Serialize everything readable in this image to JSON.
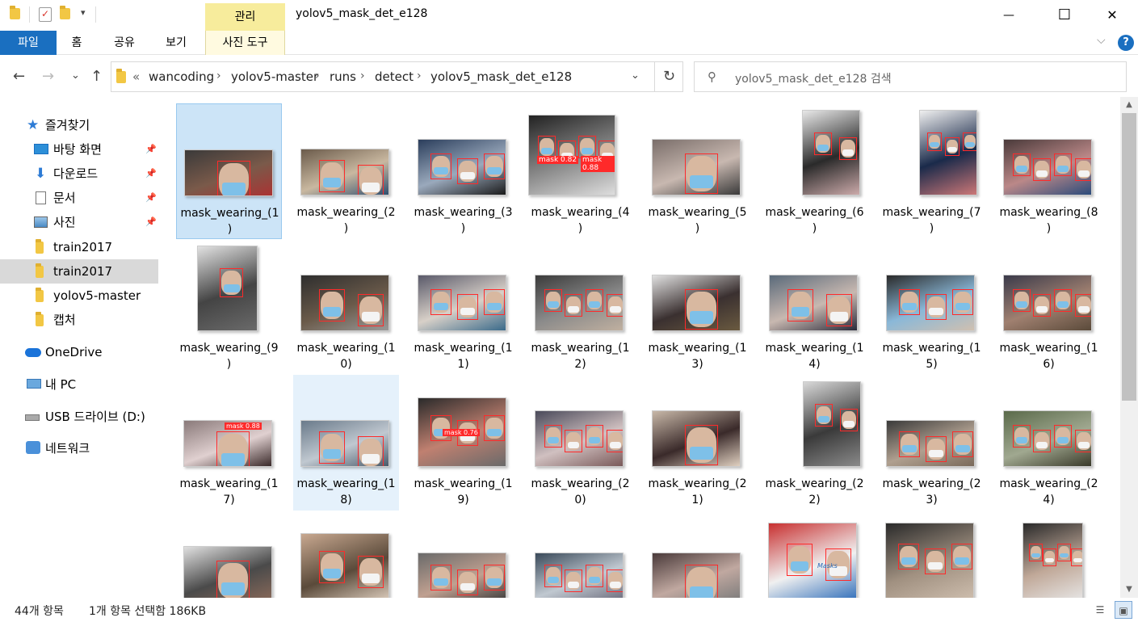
{
  "window": {
    "title": "yolov5_mask_det_e128",
    "context_tab": "관리",
    "minimize": "—",
    "maximize": "☐",
    "close": "✕"
  },
  "ribbon": {
    "tabs": [
      "파일",
      "홈",
      "공유",
      "보기",
      "사진 도구"
    ],
    "help": "?",
    "expand": "⌵"
  },
  "address": {
    "overflow": "«",
    "crumbs": [
      "wancoding",
      "yolov5-master",
      "runs",
      "detect",
      "yolov5_mask_det_e128"
    ],
    "sep": "›",
    "dropdown": "⌄",
    "refresh": "↻"
  },
  "search": {
    "placeholder": "yolov5_mask_det_e128 검색",
    "icon": "⚲"
  },
  "nav_buttons": {
    "back": "←",
    "forward": "→",
    "recent": "⌄",
    "up": "↑"
  },
  "navpane": {
    "quick_access": "즐겨찾기",
    "items": [
      {
        "label": "바탕 화면",
        "icon": "desktop-icon",
        "pinned": true
      },
      {
        "label": "다운로드",
        "icon": "download-icon",
        "pinned": true
      },
      {
        "label": "문서",
        "icon": "document-icon",
        "pinned": true
      },
      {
        "label": "사진",
        "icon": "pictures-icon",
        "pinned": true
      },
      {
        "label": "train2017",
        "icon": "folder-icon",
        "pinned": false
      },
      {
        "label": "train2017",
        "icon": "folder-icon",
        "pinned": false
      },
      {
        "label": "yolov5-master",
        "icon": "folder-icon",
        "pinned": false
      },
      {
        "label": "캡처",
        "icon": "folder-icon",
        "pinned": false
      }
    ],
    "onedrive": "OneDrive",
    "thispc": "내 PC",
    "usb": "USB 드라이브 (D:)",
    "network": "네트워크",
    "pin_glyph": "📌"
  },
  "files": [
    [
      "mask_wearing_(1",
      ")"
    ],
    [
      "mask_wearing_(2",
      ")"
    ],
    [
      "mask_wearing_(3",
      ")"
    ],
    [
      "mask_wearing_(4",
      ")"
    ],
    [
      "mask_wearing_(5",
      ")"
    ],
    [
      "mask_wearing_(6",
      ")"
    ],
    [
      "mask_wearing_(7",
      ")"
    ],
    [
      "mask_wearing_(8",
      ")"
    ],
    [
      "mask_wearing_(9",
      ")"
    ],
    [
      "mask_wearing_(1",
      "0)"
    ],
    [
      "mask_wearing_(1",
      "1)"
    ],
    [
      "mask_wearing_(1",
      "2)"
    ],
    [
      "mask_wearing_(1",
      "3)"
    ],
    [
      "mask_wearing_(1",
      "4)"
    ],
    [
      "mask_wearing_(1",
      "5)"
    ],
    [
      "mask_wearing_(1",
      "6)"
    ],
    [
      "mask_wearing_(1",
      "7)"
    ],
    [
      "mask_wearing_(1",
      "8)"
    ],
    [
      "mask_wearing_(1",
      "9)"
    ],
    [
      "mask_wearing_(2",
      "0)"
    ],
    [
      "mask_wearing_(2",
      "1)"
    ],
    [
      "mask_wearing_(2",
      "2)"
    ],
    [
      "mask_wearing_(2",
      "3)"
    ],
    [
      "mask_wearing_(2",
      "4)"
    ],
    [
      "",
      ""
    ],
    [
      "",
      ""
    ],
    [
      "",
      ""
    ],
    [
      "",
      ""
    ],
    [
      "",
      ""
    ],
    [
      "",
      ""
    ],
    [
      "",
      ""
    ],
    [
      "",
      ""
    ]
  ],
  "detection_labels": {
    "mask_a": "mask 0.82",
    "mask_b": "mask 0.88",
    "mask_c": "mask 0.76"
  },
  "thumb_banner_text": "Masks",
  "status": {
    "item_count": "44개 항목",
    "selection": "1개 항목 선택함 186KB"
  },
  "colors": {
    "accent": "#1a6fc0",
    "selection_bg": "#cce4f7",
    "hover_bg": "#e5f1fb",
    "detection_box": "#ff2a2a",
    "context_tab": "#f7ec9c"
  }
}
